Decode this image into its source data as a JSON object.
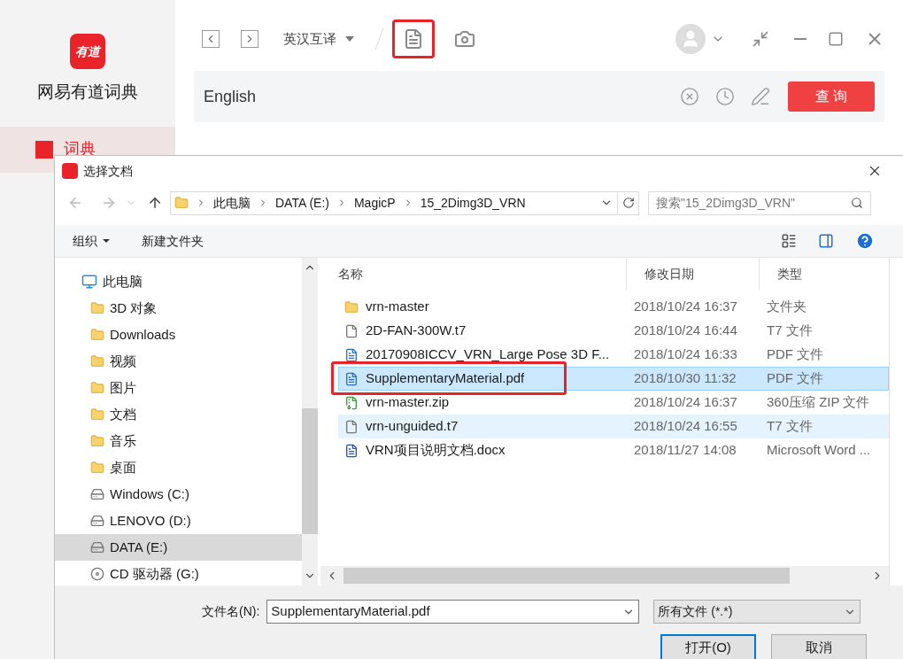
{
  "app": {
    "logo_text": "有道",
    "name": "网易有道词典",
    "nav": [
      {
        "label": "词典",
        "selected": true
      }
    ],
    "toolbar": {
      "language": "英汉互译",
      "tools": [
        {
          "kind": "document",
          "annotated": true
        },
        {
          "kind": "camera",
          "annotated": false
        }
      ]
    },
    "search": {
      "value": "English",
      "button": "查 询"
    }
  },
  "dialog": {
    "title": "选择文档",
    "breadcrumb": [
      "此电脑",
      "DATA (E:)",
      "MagicP",
      "15_2Dimg3D_VRN"
    ],
    "search_placeholder": "搜索\"15_2Dimg3D_VRN\"",
    "commands": [
      {
        "label": "组织",
        "dropdown": true
      },
      {
        "label": "新建文件夹",
        "dropdown": false
      }
    ],
    "tree": [
      {
        "label": "此电脑",
        "kind": "computer",
        "selected": false,
        "children": [
          {
            "label": "3D 对象",
            "kind": "folder",
            "selected": false
          },
          {
            "label": "Downloads",
            "kind": "folder",
            "selected": false
          },
          {
            "label": "视频",
            "kind": "folder",
            "selected": false
          },
          {
            "label": "图片",
            "kind": "folder",
            "selected": false
          },
          {
            "label": "文档",
            "kind": "folder",
            "selected": false
          },
          {
            "label": "音乐",
            "kind": "folder",
            "selected": false
          },
          {
            "label": "桌面",
            "kind": "folder",
            "selected": false
          },
          {
            "label": "Windows (C:)",
            "kind": "drive",
            "selected": false
          },
          {
            "label": "LENOVO (D:)",
            "kind": "drive",
            "selected": false
          },
          {
            "label": "DATA (E:)",
            "kind": "drive",
            "selected": true
          },
          {
            "label": "CD 驱动器 (G:)",
            "kind": "cd",
            "selected": false
          }
        ]
      }
    ],
    "columns": [
      "名称",
      "修改日期",
      "类型"
    ],
    "files": [
      {
        "name": "vrn-master",
        "date": "2018/10/24 16:37",
        "type": "文件夹",
        "kind": "folder",
        "selected": false,
        "hovered": false,
        "annotated": false
      },
      {
        "name": "2D-FAN-300W.t7",
        "date": "2018/10/24 16:44",
        "type": "T7 文件",
        "kind": "file",
        "selected": false,
        "hovered": false,
        "annotated": false
      },
      {
        "name": "20170908ICCV_VRN_Large Pose 3D F...",
        "date": "2018/10/24 16:33",
        "type": "PDF 文件",
        "kind": "pdf",
        "selected": false,
        "hovered": false,
        "annotated": false
      },
      {
        "name": "SupplementaryMaterial.pdf",
        "date": "2018/10/30 11:32",
        "type": "PDF 文件",
        "kind": "pdf",
        "selected": true,
        "hovered": false,
        "annotated": true
      },
      {
        "name": "vrn-master.zip",
        "date": "2018/10/24 16:37",
        "type": "360压缩 ZIP 文件",
        "kind": "zip",
        "selected": false,
        "hovered": false,
        "annotated": false
      },
      {
        "name": "vrn-unguided.t7",
        "date": "2018/10/24 16:55",
        "type": "T7 文件",
        "kind": "file",
        "selected": false,
        "hovered": true,
        "annotated": false
      },
      {
        "name": "VRN项目说明文档.docx",
        "date": "2018/11/27 14:08",
        "type": "Microsoft Word ...",
        "kind": "word",
        "selected": false,
        "hovered": false,
        "annotated": false
      }
    ],
    "filename_label": "文件名(N):",
    "filename": "SupplementaryMaterial.pdf",
    "filter": "所有文件 (*.*)",
    "buttons": [
      {
        "label": "打开(O)",
        "primary": true
      },
      {
        "label": "取消",
        "primary": false
      }
    ]
  }
}
